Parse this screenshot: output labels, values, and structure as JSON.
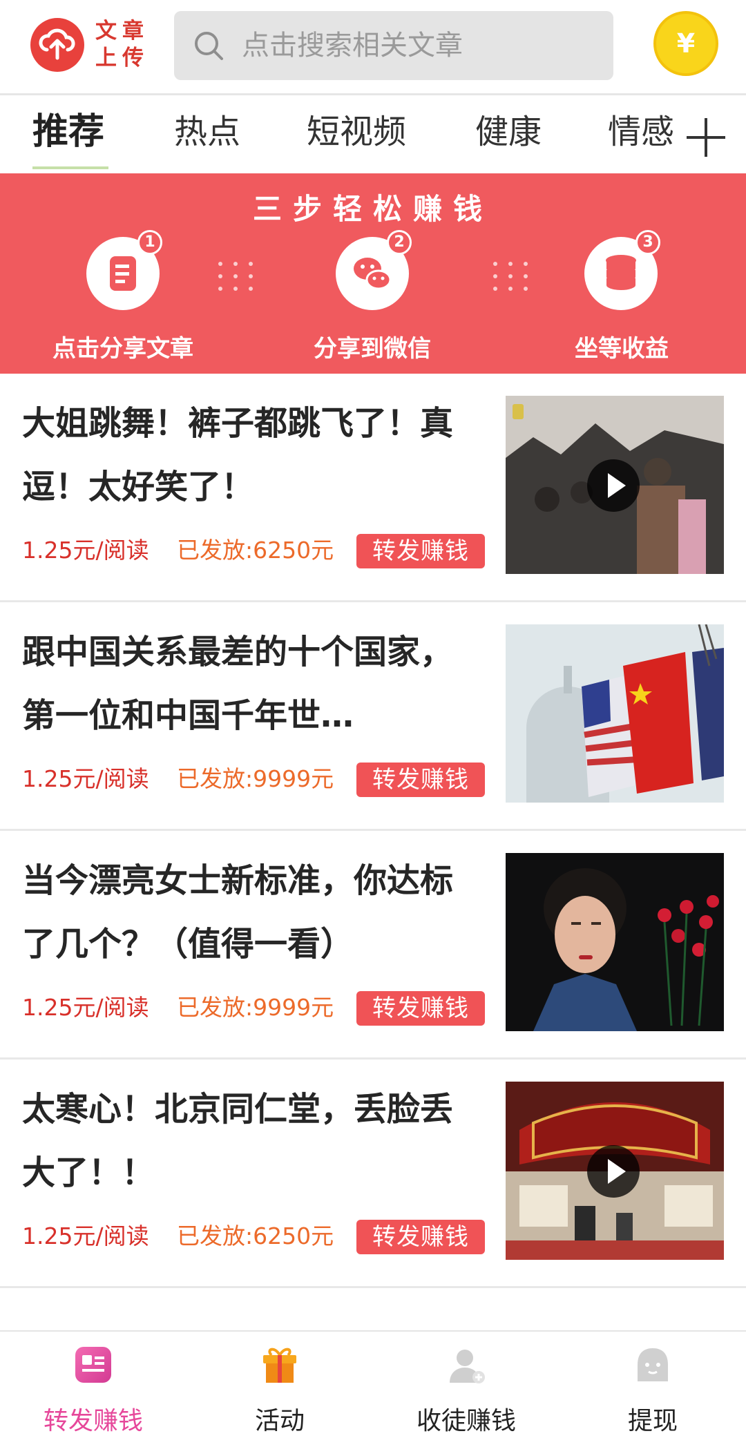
{
  "header": {
    "logo_text": "文章上传",
    "logo_icon": "upload-cloud-icon",
    "search_placeholder": "点击搜索相关文章",
    "coin_symbol": "¥"
  },
  "tabs": [
    {
      "label": "推荐",
      "active": true
    },
    {
      "label": "热点",
      "active": false
    },
    {
      "label": "短视频",
      "active": false
    },
    {
      "label": "健康",
      "active": false
    },
    {
      "label": "情感",
      "active": false
    }
  ],
  "banner": {
    "title": "三步轻松赚钱",
    "steps": [
      {
        "num": "1",
        "label": "点击分享文章",
        "icon": "article-icon"
      },
      {
        "num": "2",
        "label": "分享到微信",
        "icon": "wechat-icon"
      },
      {
        "num": "3",
        "label": "坐等收益",
        "icon": "coins-stack-icon"
      }
    ]
  },
  "articles": [
    {
      "title": "大姐跳舞！裤子都跳飞了！真逗！太好笑了！",
      "price": "1.25元/阅读",
      "paid": "已发放:6250元",
      "button": "转发赚钱",
      "video": true
    },
    {
      "title": "跟中国关系最差的十个国家，第一位和中国千年世…",
      "price": "1.25元/阅读",
      "paid": "已发放:9999元",
      "button": "转发赚钱",
      "video": false
    },
    {
      "title": "当今漂亮女士新标准，你达标了几个？（值得一看）",
      "price": "1.25元/阅读",
      "paid": "已发放:9999元",
      "button": "转发赚钱",
      "video": false
    },
    {
      "title": "太寒心！北京同仁堂，丢脸丢大了！！",
      "price": "1.25元/阅读",
      "paid": "已发放:6250元",
      "button": "转发赚钱",
      "video": true
    }
  ],
  "bottom_nav": [
    {
      "label": "转发赚钱",
      "icon": "share-earn-icon",
      "active": true
    },
    {
      "label": "活动",
      "icon": "gift-icon",
      "active": false
    },
    {
      "label": "收徒赚钱",
      "icon": "add-user-icon",
      "active": false
    },
    {
      "label": "提现",
      "icon": "withdraw-icon",
      "active": false
    }
  ],
  "colors": {
    "accent_red": "#f05a5e",
    "price_red": "#d8302a",
    "paid_orange": "#ec6a2a",
    "nav_active": "#e6479a",
    "coin_yellow": "#f9d51b"
  }
}
